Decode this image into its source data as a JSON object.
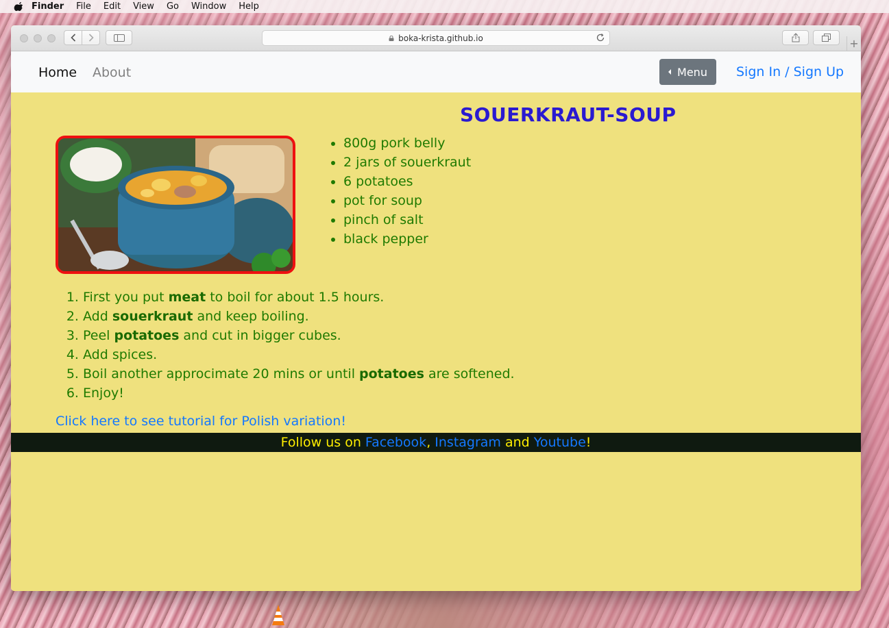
{
  "menubar": {
    "app": "Finder",
    "items": [
      "File",
      "Edit",
      "View",
      "Go",
      "Window",
      "Help"
    ]
  },
  "browser": {
    "url": "boka-krista.github.io"
  },
  "nav": {
    "home": "Home",
    "about": "About",
    "menu_button": "Menu",
    "signin": "Sign In / Sign Up"
  },
  "recipe": {
    "title": "SOUERKRAUT-SOUP",
    "ingredients": [
      "800g pork belly",
      "2 jars of souerkraut",
      "6 potatoes",
      "pot for soup",
      "pinch of salt",
      "black pepper"
    ],
    "steps": [
      {
        "before": "First you put ",
        "bold": "meat",
        "after": " to boil for about 1.5 hours."
      },
      {
        "before": "Add ",
        "bold": "souerkraut",
        "after": " and keep boiling."
      },
      {
        "before": "Peel ",
        "bold": "potatoes",
        "after": " and cut in bigger cubes."
      },
      {
        "before": "Add spices.",
        "bold": "",
        "after": ""
      },
      {
        "before": "Boil another approcimate 20 mins or until ",
        "bold": "potatoes",
        "after": " are softened."
      },
      {
        "before": "Enjoy!",
        "bold": "",
        "after": ""
      }
    ],
    "tutorial_link": "Click here to see tutorial for Polish variation!"
  },
  "footer": {
    "prefix": "Follow us on ",
    "facebook": "Facebook",
    "sep1": ", ",
    "instagram": "Instagram",
    "sep2": " and ",
    "youtube": "Youtube",
    "suffix": "!"
  },
  "colors": {
    "page_bg": "#efe17e",
    "title": "#2a1ad0",
    "text_green": "#1f7a00",
    "link_blue": "#1478ff",
    "footer_bg": "#0f1a10",
    "footer_text": "#ffee00",
    "image_border": "#ee1010"
  }
}
